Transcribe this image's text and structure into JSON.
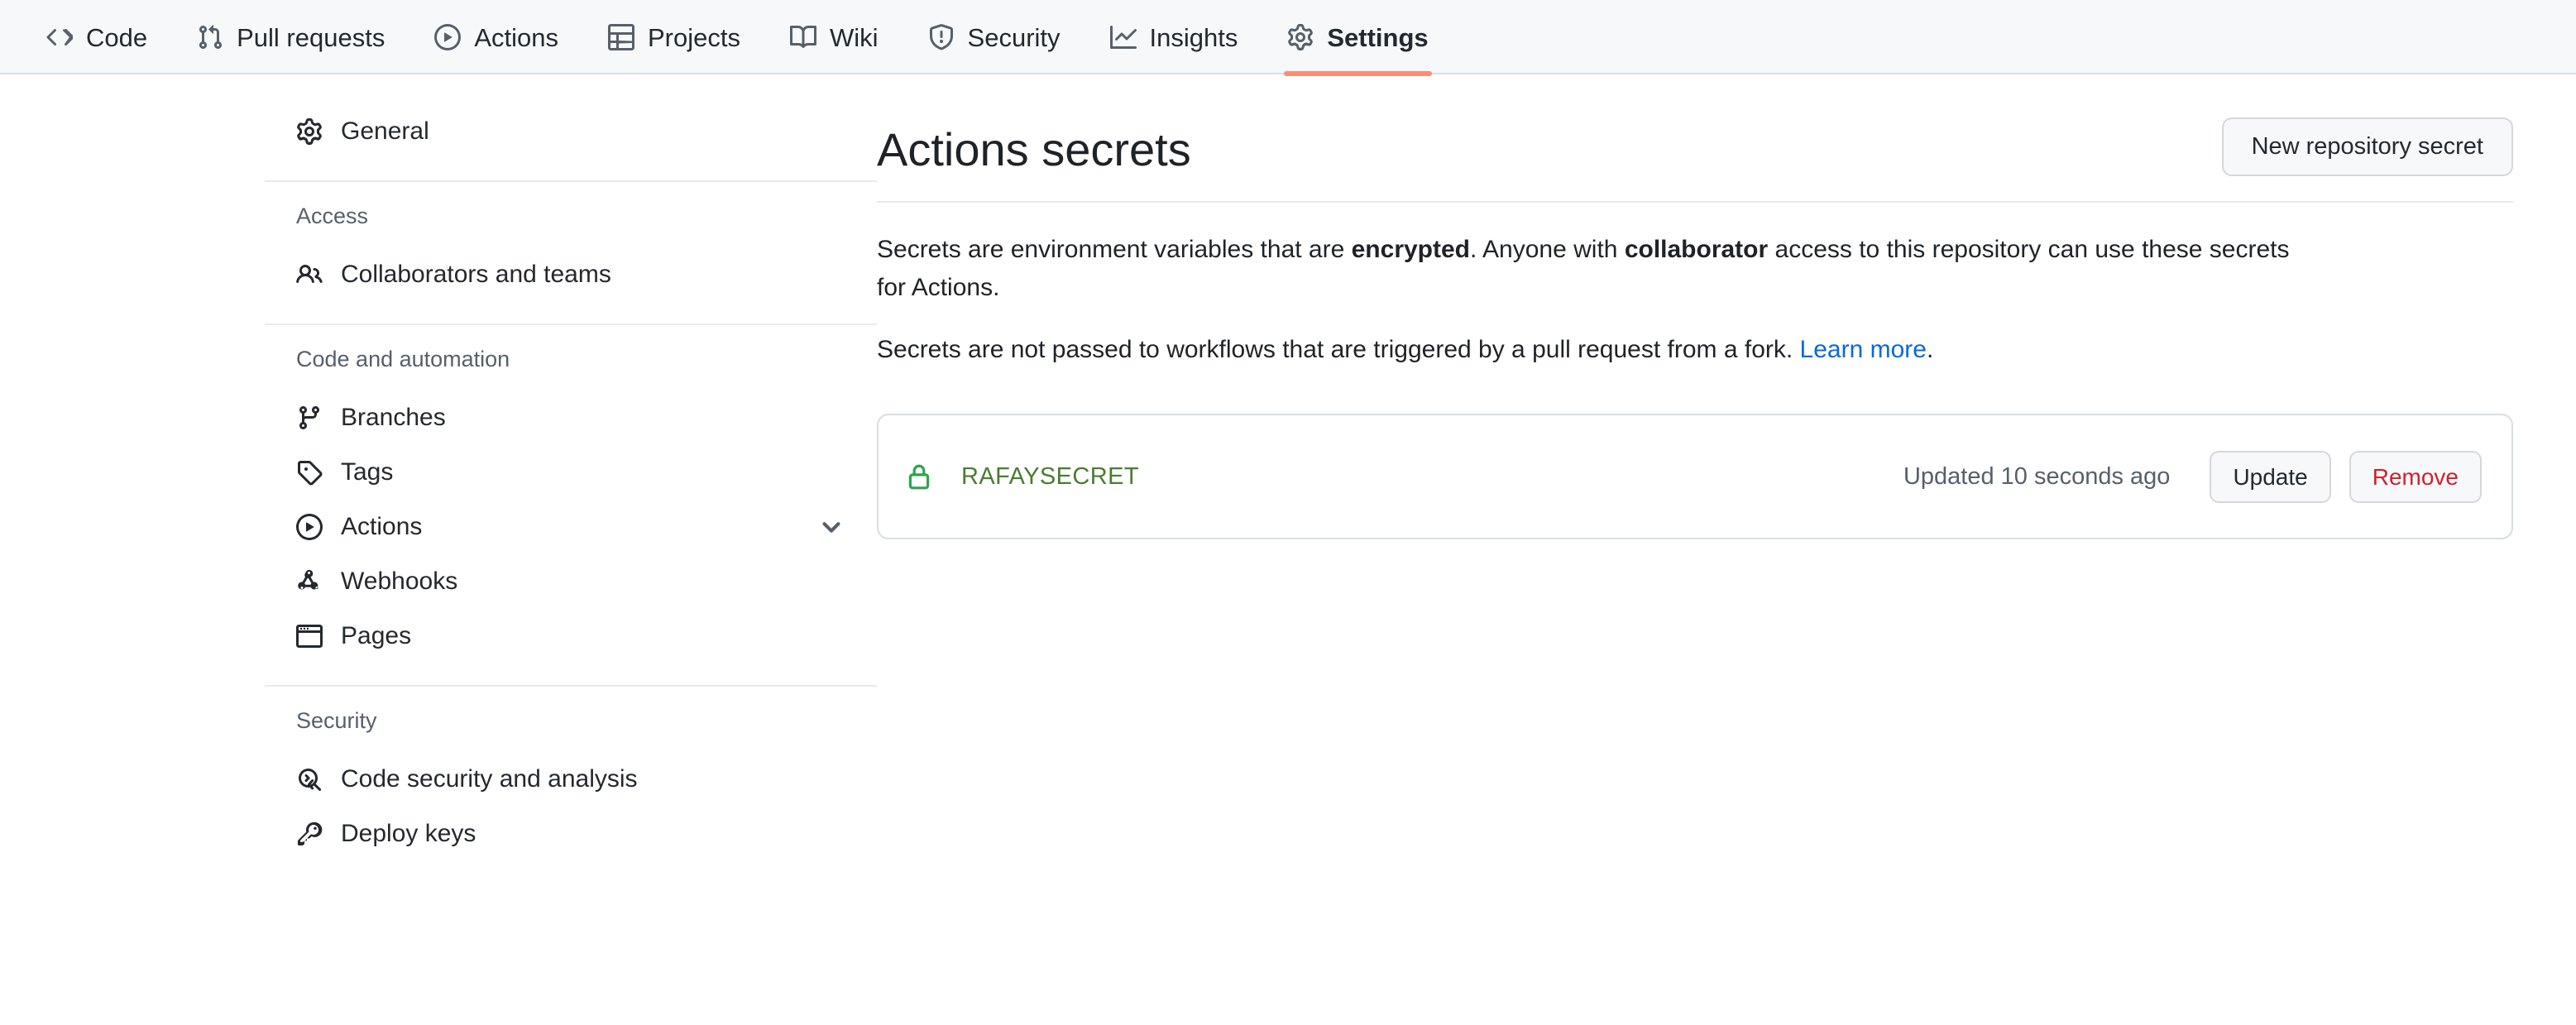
{
  "repo_nav": {
    "tabs": [
      {
        "label": "Code",
        "icon": "code-icon",
        "active": false
      },
      {
        "label": "Pull requests",
        "icon": "git-pull-request-icon",
        "active": false
      },
      {
        "label": "Actions",
        "icon": "play-circle-icon",
        "active": false
      },
      {
        "label": "Projects",
        "icon": "table-icon",
        "active": false
      },
      {
        "label": "Wiki",
        "icon": "book-icon",
        "active": false
      },
      {
        "label": "Security",
        "icon": "shield-alert-icon",
        "active": false
      },
      {
        "label": "Insights",
        "icon": "graph-icon",
        "active": false
      },
      {
        "label": "Settings",
        "icon": "gear-icon",
        "active": true
      }
    ]
  },
  "sidebar": {
    "top_items": [
      {
        "label": "General",
        "icon": "gear-icon"
      }
    ],
    "groups": [
      {
        "title": "Access",
        "items": [
          {
            "label": "Collaborators and teams",
            "icon": "people-icon",
            "chevron": false
          }
        ]
      },
      {
        "title": "Code and automation",
        "items": [
          {
            "label": "Branches",
            "icon": "git-branch-icon",
            "chevron": false
          },
          {
            "label": "Tags",
            "icon": "tag-icon",
            "chevron": false
          },
          {
            "label": "Actions",
            "icon": "play-circle-icon",
            "chevron": true
          },
          {
            "label": "Webhooks",
            "icon": "webhook-icon",
            "chevron": false
          },
          {
            "label": "Pages",
            "icon": "browser-icon",
            "chevron": false
          }
        ]
      },
      {
        "title": "Security",
        "items": [
          {
            "label": "Code security and analysis",
            "icon": "codescan-icon",
            "chevron": false
          },
          {
            "label": "Deploy keys",
            "icon": "key-icon",
            "chevron": false
          }
        ]
      }
    ]
  },
  "main": {
    "title": "Actions secrets",
    "new_secret_label": "New repository secret",
    "description_1": {
      "part1": "Secrets are environment variables that are ",
      "bold1": "encrypted",
      "part2": ". Anyone with ",
      "bold2": "collaborator",
      "part3": " access to this repository can use these secrets for Actions."
    },
    "description_2": {
      "part1": "Secrets are not passed to workflows that are triggered by a pull request from a fork. ",
      "link": "Learn more",
      "part2": "."
    },
    "secrets": [
      {
        "name": "RAFAYSECRET",
        "icon": "lock-icon",
        "updated": "Updated 10 seconds ago",
        "update_label": "Update",
        "remove_label": "Remove"
      }
    ]
  },
  "colors": {
    "accent_underline": "#fd8c73",
    "link": "#0969da",
    "danger": "#cf222e",
    "secret_green": "#4a7c2f",
    "header_bg": "#f6f8fa"
  }
}
